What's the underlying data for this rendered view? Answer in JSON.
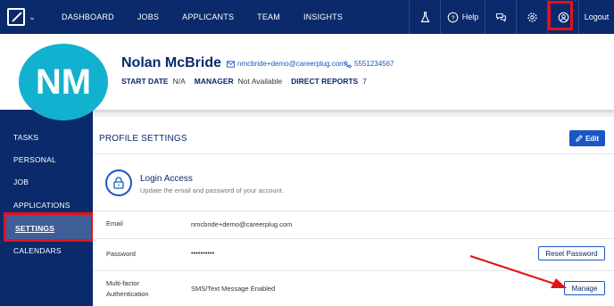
{
  "nav": {
    "links": [
      "DASHBOARD",
      "JOBS",
      "APPLICANTS",
      "TEAM",
      "INSIGHTS"
    ],
    "help_label": "Help",
    "logout_label": "Logout"
  },
  "profile": {
    "initials": "NM",
    "name": "Nolan McBride",
    "email": "nmcbride+demo@careerplug.com",
    "phone": "5551234567",
    "start_date_label": "START DATE",
    "start_date_value": "N/A",
    "manager_label": "MANAGER",
    "manager_value": "Not Available",
    "direct_reports_label": "DIRECT REPORTS",
    "direct_reports_value": "7"
  },
  "sidebar": {
    "items": [
      "TASKS",
      "PERSONAL",
      "JOB",
      "APPLICATIONS",
      "SETTINGS",
      "CALENDARS"
    ],
    "active": "SETTINGS"
  },
  "settings": {
    "title": "PROFILE SETTINGS",
    "edit_label": "Edit",
    "login_title": "Login Access",
    "login_subtitle": "Update the email and password of your account.",
    "email_label": "Email",
    "email_value": "nmcbride+demo@careerplug.com",
    "password_label": "Password",
    "password_value": "••••••••••",
    "reset_password_label": "Reset Password",
    "mfa_label_line1": "Multi-factor",
    "mfa_label_line2": "Authentication",
    "mfa_value": "SMS/Text Message Enabled",
    "manage_label": "Manage"
  },
  "colors": {
    "nav_bg": "#0a2a6b",
    "accent": "#1a56c4",
    "avatar_bg": "#12b1cf",
    "highlight": "#e3121b"
  }
}
